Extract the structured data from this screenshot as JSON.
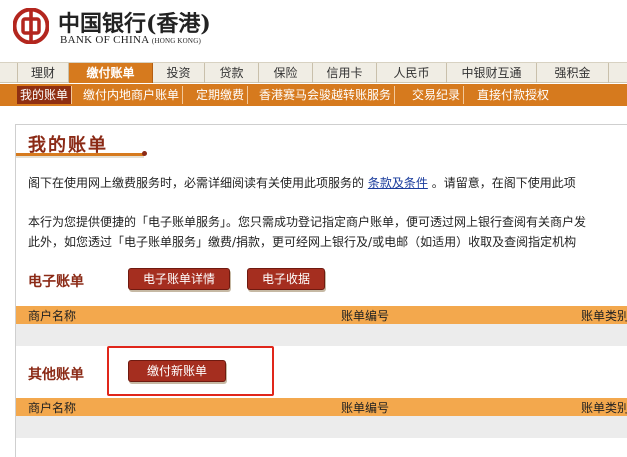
{
  "header": {
    "logo_cn": "中国银行(香港)",
    "logo_en": "BANK OF CHINA",
    "logo_en_sub": "(HONG KONG)"
  },
  "main_nav": {
    "tabs": [
      {
        "label": "理财",
        "active": false
      },
      {
        "label": "缴付账单",
        "active": true
      },
      {
        "label": "投资",
        "active": false
      },
      {
        "label": "贷款",
        "active": false
      },
      {
        "label": "保险",
        "active": false
      },
      {
        "label": "信用卡",
        "active": false
      },
      {
        "label": "人民币",
        "active": false
      },
      {
        "label": "中银财互通",
        "active": false
      },
      {
        "label": "强积金",
        "active": false
      }
    ]
  },
  "sub_nav": {
    "items": [
      {
        "label": "我的账单",
        "active": true
      },
      {
        "label": "缴付内地商户账单",
        "active": false
      },
      {
        "label": "定期缴费",
        "active": false
      },
      {
        "label": "香港赛马会骏越转账服务",
        "active": false
      },
      {
        "label": "交易纪录",
        "active": false
      },
      {
        "label": "直接付款授权",
        "active": false
      }
    ]
  },
  "page": {
    "title": "我的账单",
    "intro_before_link": "阁下在使用网上缴费服务时，必需详细阅读有关使用此项服务的",
    "terms_link": "条款及条件",
    "intro_after_link": "。请留意，在阁下使用此项",
    "para2_line1": "本行为您提供便捷的「电子账单服务」。您只需成功登记指定商户账单，便可透过网上银行查阅有关商户发",
    "para2_line2": "此外，如您透过「电子账单服务」缴费/捐款，更可经网上银行及/或电邮（如适用）收取及查阅指定机构",
    "ebill": {
      "label": "电子账单",
      "details_button": "电子账单详情",
      "receipt_button": "电子收据",
      "columns": [
        "商户名称",
        "账单编号",
        "账单类别"
      ]
    },
    "other": {
      "label": "其他账单",
      "pay_new_button": "缴付新账单",
      "columns": [
        "商户名称",
        "账单编号",
        "账单类别"
      ]
    }
  },
  "colors": {
    "accent_orange": "#d67a1e",
    "brand_dark_red": "#8b2a16",
    "button_red": "#a52e1f",
    "table_header": "#f3a84d",
    "link_blue": "#1a3c9c",
    "highlight_red": "#e0261a"
  }
}
